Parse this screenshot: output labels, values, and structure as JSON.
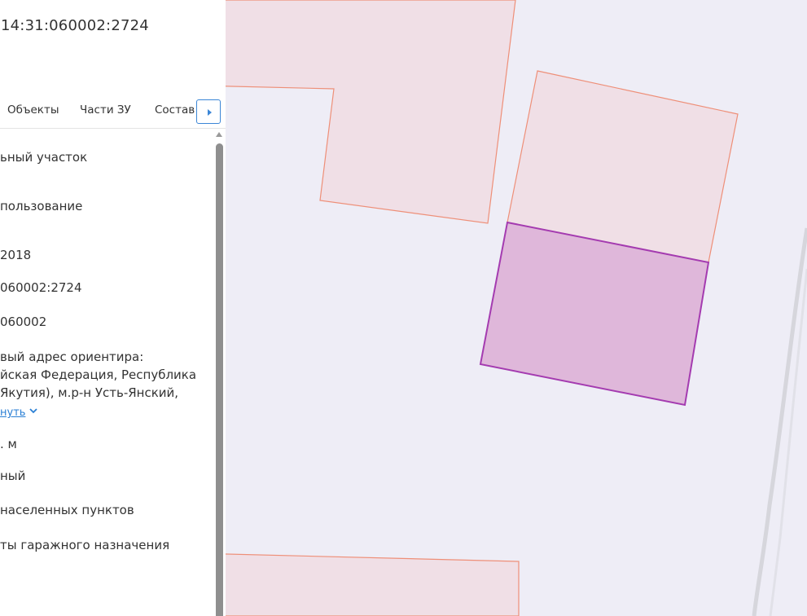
{
  "panel": {
    "cadastral_number_title": "14:31:060002:2724",
    "tabs": [
      {
        "label": "Объекты"
      },
      {
        "label": "Части ЗУ"
      },
      {
        "label": "Состав"
      }
    ],
    "fields": [
      "ьный участок",
      "пользование",
      "2018",
      "060002:2724",
      "060002",
      "вый адрес ориентира:",
      "йская Федерация, Республика",
      "Якутия), м.р-н Усть-Янский,",
      ". м",
      "ный",
      " населенных пунктов",
      "ты гаражного назначения"
    ],
    "expand_label": "нуть"
  },
  "map": {
    "colors": {
      "background": "#eeedf6",
      "parcel_fill": "#f0dfe6",
      "parcel_stroke": "#ee8f78",
      "selected_fill": "#dfb7da",
      "selected_stroke": "#a43bb0"
    }
  }
}
